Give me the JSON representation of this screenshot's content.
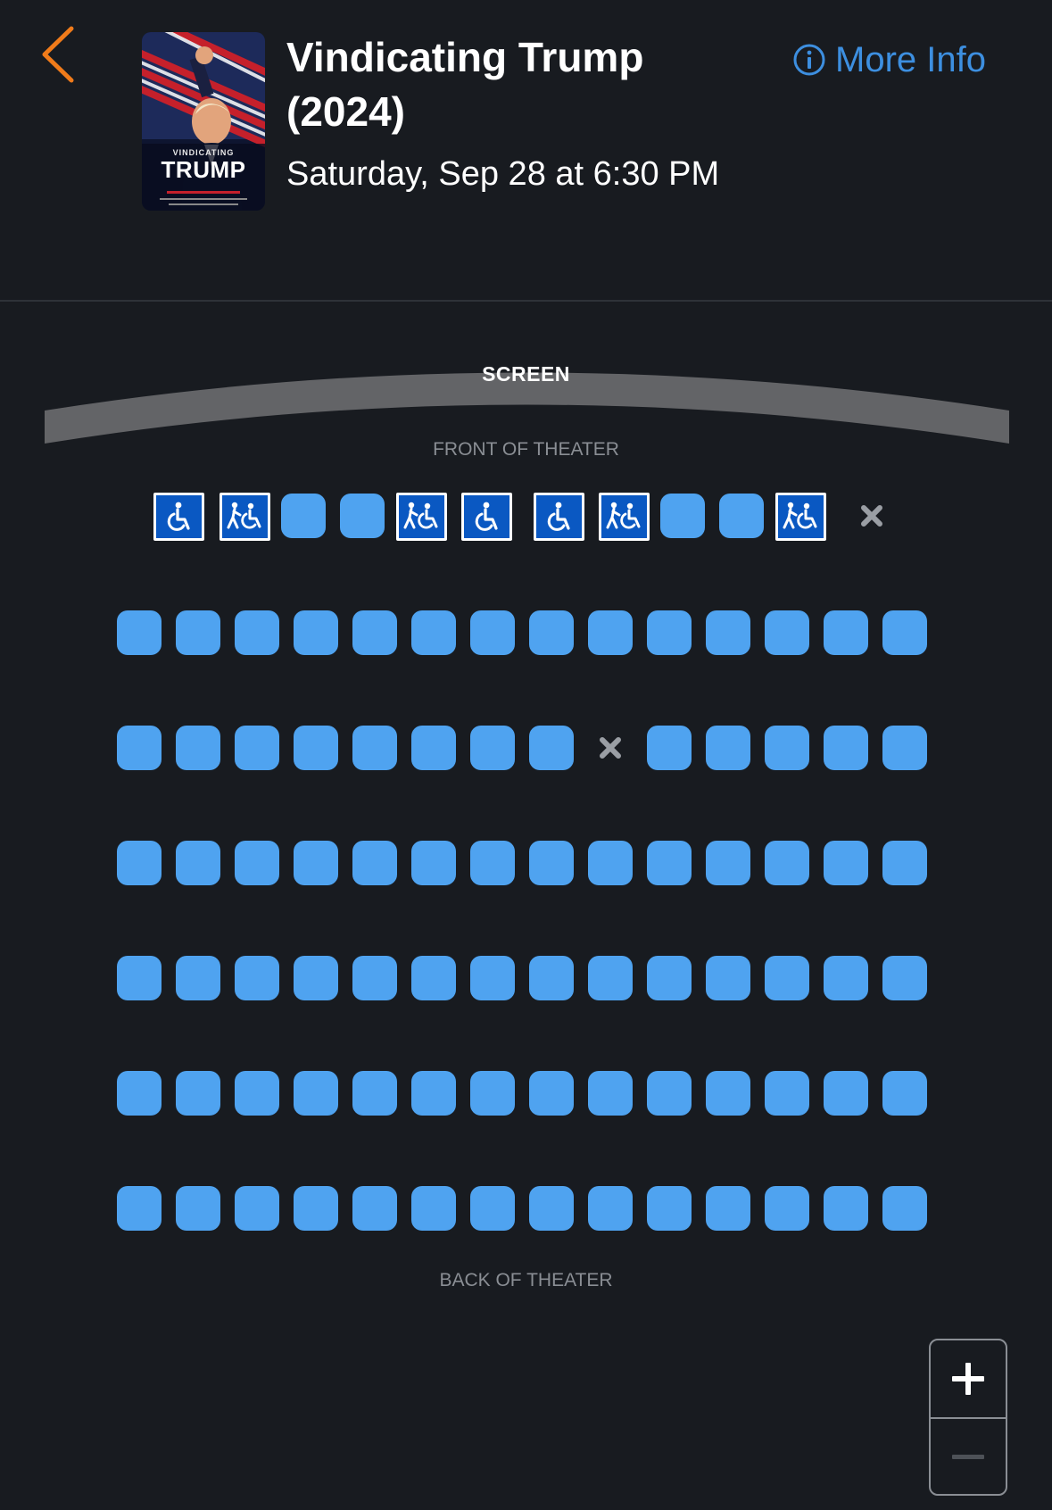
{
  "header": {
    "title": "Vindicating Trump (2024)",
    "datetime": "Saturday, Sep 28 at 6:30 PM",
    "more_info_label": "More Info",
    "back_icon": "chevron-left-icon",
    "info_icon": "info-circle-icon",
    "poster": {
      "small_text": "VINDICATING",
      "big_text": "TRUMP"
    }
  },
  "theater": {
    "screen_label": "SCREEN",
    "front_label": "FRONT OF THEATER",
    "back_label": "BACK OF THEATER"
  },
  "seat_rows": [
    [
      "wheelchair",
      "companion",
      "seat",
      "seat",
      "companion",
      "wheelchair",
      "wheelchair",
      "companion",
      "seat",
      "seat",
      "companion",
      "unavailable"
    ],
    [
      "seat",
      "seat",
      "seat",
      "seat",
      "seat",
      "seat",
      "seat",
      "seat",
      "seat",
      "seat",
      "seat",
      "seat",
      "seat",
      "seat"
    ],
    [
      "seat",
      "seat",
      "seat",
      "seat",
      "seat",
      "seat",
      "seat",
      "seat",
      "unavailable",
      "seat",
      "seat",
      "seat",
      "seat",
      "seat"
    ],
    [
      "seat",
      "seat",
      "seat",
      "seat",
      "seat",
      "seat",
      "seat",
      "seat",
      "seat",
      "seat",
      "seat",
      "seat",
      "seat",
      "seat"
    ],
    [
      "seat",
      "seat",
      "seat",
      "seat",
      "seat",
      "seat",
      "seat",
      "seat",
      "seat",
      "seat",
      "seat",
      "seat",
      "seat",
      "seat"
    ],
    [
      "seat",
      "seat",
      "seat",
      "seat",
      "seat",
      "seat",
      "seat",
      "seat",
      "seat",
      "seat",
      "seat",
      "seat",
      "seat",
      "seat"
    ],
    [
      "seat",
      "seat",
      "seat",
      "seat",
      "seat",
      "seat",
      "seat",
      "seat",
      "seat",
      "seat",
      "seat",
      "seat",
      "seat",
      "seat"
    ]
  ],
  "zoom": {
    "zoom_in_icon": "plus-icon",
    "zoom_out_icon": "minus-icon"
  },
  "colors": {
    "background": "#181b20",
    "accent_orange": "#f07b1a",
    "link_blue": "#3d8fe0",
    "seat_available": "#4fa3f0",
    "seat_accessible": "#0a58c2",
    "screen_gray": "#636467"
  }
}
